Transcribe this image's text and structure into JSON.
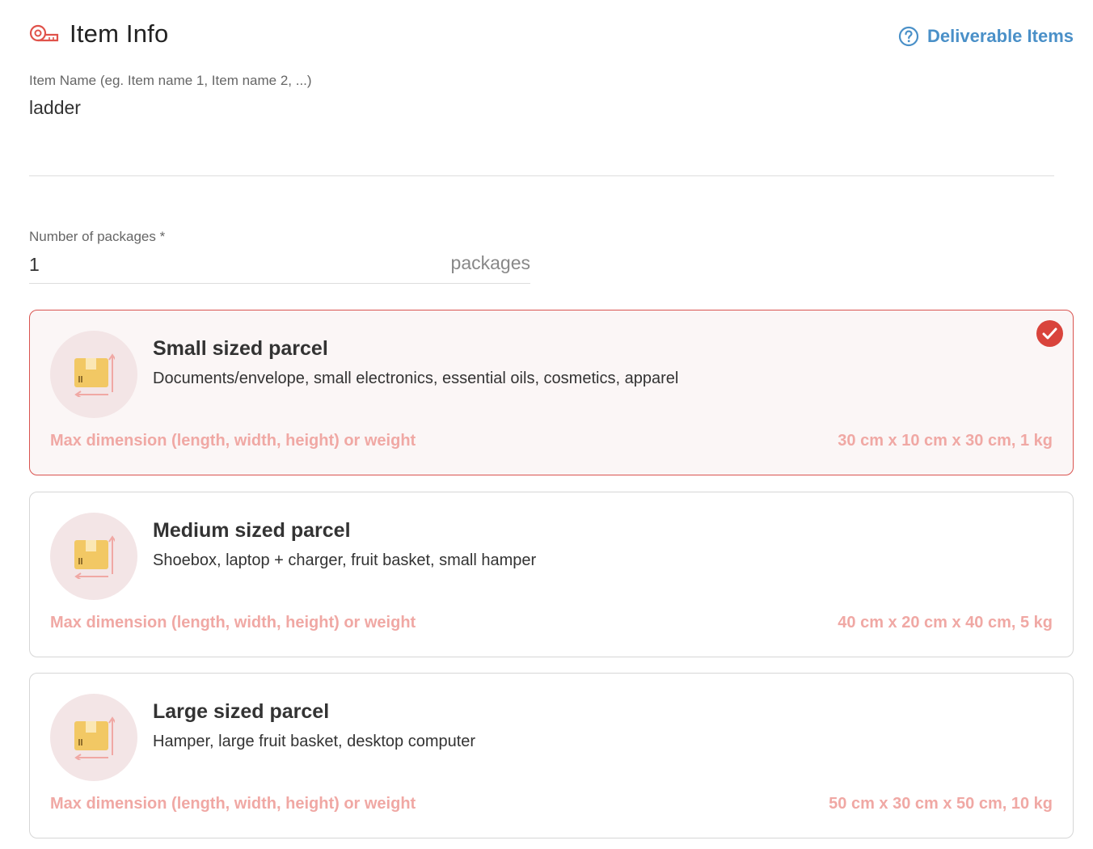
{
  "header": {
    "title": "Item Info",
    "title_icon": "measuring-tape-icon",
    "help_link": "Deliverable Items",
    "help_icon": "question-circle-icon"
  },
  "item_name": {
    "label": "Item Name (eg. Item name 1, Item name 2, ...)",
    "value": "ladder"
  },
  "packages": {
    "label": "Number of packages",
    "required_mark": "*",
    "value": "1",
    "unit": "packages"
  },
  "parcels": [
    {
      "title": "Small sized parcel",
      "description": "Documents/envelope, small electronics, essential oils, cosmetics, apparel",
      "dim_label": "Max dimension (length, width, height) or weight",
      "dim_value": "30 cm x 10 cm x 30 cm, 1 kg",
      "selected": true,
      "icon": "parcel-box-icon"
    },
    {
      "title": "Medium sized parcel",
      "description": "Shoebox, laptop + charger, fruit basket, small hamper",
      "dim_label": "Max dimension (length, width, height) or weight",
      "dim_value": "40 cm x 20 cm x 40 cm, 5 kg",
      "selected": false,
      "icon": "parcel-box-icon"
    },
    {
      "title": "Large sized parcel",
      "description": "Hamper, large fruit basket, desktop computer",
      "dim_label": "Max dimension (length, width, height) or weight",
      "dim_value": "50 cm x 30 cm x 50 cm, 10 kg",
      "selected": false,
      "icon": "parcel-box-icon"
    }
  ],
  "colors": {
    "accent_red": "#d9443c",
    "link_blue": "#4a90c8",
    "dimension_pink": "#f0a8a4",
    "box_yellow": "#f2c864"
  }
}
